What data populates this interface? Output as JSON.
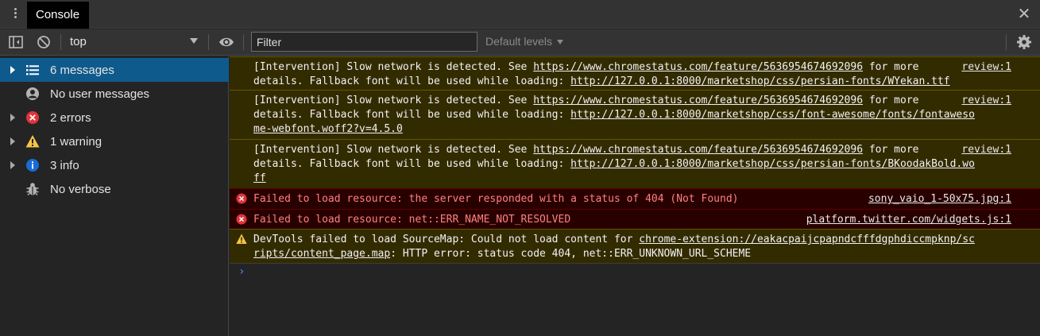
{
  "tabbar": {
    "tab_label": "Console"
  },
  "toolbar": {
    "context": "top",
    "filter_placeholder": "Filter",
    "levels_label": "Default levels"
  },
  "sidebar": {
    "items": [
      {
        "label": "6 messages",
        "icon": "list-icon",
        "selected": true,
        "expandable": true
      },
      {
        "label": "No user messages",
        "icon": "user-icon",
        "selected": false,
        "expandable": false
      },
      {
        "label": "2 errors",
        "icon": "error-icon",
        "selected": false,
        "expandable": true
      },
      {
        "label": "1 warning",
        "icon": "warning-icon",
        "selected": false,
        "expandable": true
      },
      {
        "label": "3 info",
        "icon": "info-icon",
        "selected": false,
        "expandable": true
      },
      {
        "label": "No verbose",
        "icon": "bug-icon",
        "selected": false,
        "expandable": false
      }
    ]
  },
  "messages": [
    {
      "level": "warning",
      "pre": "[Intervention] Slow network is detected. See ",
      "url": "https://www.chromestatus.com/feature/5636954674692096",
      "mid": " for more\ndetails. Fallback font will be used while loading: ",
      "url2": "http://127.0.0.1:8000/marketshop/css/persian-fonts/WYekan.ttf",
      "source": "review:1"
    },
    {
      "level": "warning",
      "pre": "[Intervention] Slow network is detected. See ",
      "url": "https://www.chromestatus.com/feature/5636954674692096",
      "mid": " for more\ndetails. Fallback font will be used while loading: ",
      "url2": "http://127.0.0.1:8000/marketshop/css/font-awesome/fonts/fontaweso\nme-webfont.woff2?v=4.5.0",
      "source": "review:1"
    },
    {
      "level": "warning",
      "pre": "[Intervention] Slow network is detected. See ",
      "url": "https://www.chromestatus.com/feature/5636954674692096",
      "mid": " for more\ndetails. Fallback font will be used while loading: ",
      "url2": "http://127.0.0.1:8000/marketshop/css/persian-fonts/BKoodakBold.wo\nff",
      "source": "review:1"
    },
    {
      "level": "error",
      "pre": "Failed to load resource: the server responded with a status of 404 (Not Found)",
      "source": "sony_vaio_1-50x75.jpg:1"
    },
    {
      "level": "error",
      "pre": "Failed to load resource: net::ERR_NAME_NOT_RESOLVED",
      "source": "platform.twitter.com/widgets.js:1"
    },
    {
      "level": "warning",
      "pre": "DevTools failed to load SourceMap: Could not load content for ",
      "url": "chrome-extension://eakacpaijcpapndcfffdgphdiccmpknp/sc\nripts/content_page.map",
      "mid": ": HTTP error: status code 404, net::ERR_UNKNOWN_URL_SCHEME",
      "source": ""
    }
  ],
  "colors": {
    "accent": "#0f5a8c",
    "error_red": "#e0343a",
    "warning_yellow": "#f5c542",
    "info_blue": "#1a6bd6",
    "prompt_blue": "#4a8ff5"
  }
}
